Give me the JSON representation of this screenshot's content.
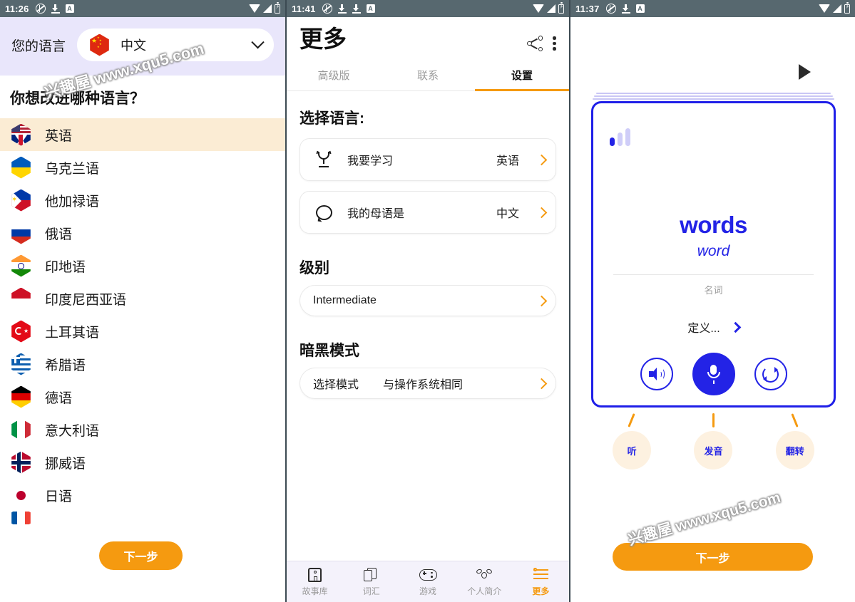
{
  "panel1": {
    "statusbar": {
      "time": "11:26",
      "icons_left": [
        "mute-icon",
        "download-icon",
        "app-badge-icon"
      ],
      "icons_right": [
        "wifi-icon",
        "signal-icon",
        "battery-icon"
      ]
    },
    "header": {
      "label": "您的语言",
      "selected_language": "中文",
      "flag": "cn",
      "chevron": "chevron-down-icon"
    },
    "question": "你想改进哪种语言？",
    "languages": [
      {
        "name": "英语",
        "flag": "uk-us",
        "selected": true
      },
      {
        "name": "乌克兰语",
        "flag": "ua",
        "selected": false
      },
      {
        "name": "他加禄语",
        "flag": "ph",
        "selected": false
      },
      {
        "name": "俄语",
        "flag": "ru",
        "selected": false
      },
      {
        "name": "印地语",
        "flag": "in",
        "selected": false
      },
      {
        "name": "印度尼西亚语",
        "flag": "id",
        "selected": false
      },
      {
        "name": "土耳其语",
        "flag": "tr",
        "selected": false
      },
      {
        "name": "希腊语",
        "flag": "gr",
        "selected": false
      },
      {
        "name": "德语",
        "flag": "de",
        "selected": false
      },
      {
        "name": "意大利语",
        "flag": "it",
        "selected": false
      },
      {
        "name": "挪威语",
        "flag": "no",
        "selected": false
      },
      {
        "name": "日语",
        "flag": "jp",
        "selected": false
      },
      {
        "name": "",
        "flag": "fr",
        "selected": false
      }
    ],
    "next_button": "下一步",
    "watermark": "兴趣屋 www.xqu5.com"
  },
  "panel2": {
    "statusbar": {
      "time": "11:41"
    },
    "title": "更多",
    "actions": {
      "share": "share-icon",
      "menu": "overflow-menu-icon"
    },
    "tabs": [
      {
        "label": "高级版",
        "active": false
      },
      {
        "label": "联系",
        "active": false
      },
      {
        "label": "设置",
        "active": true
      }
    ],
    "language_section": {
      "title": "选择语言:",
      "rows": [
        {
          "icon": "trophy-icon",
          "label": "我要学习",
          "value": "英语"
        },
        {
          "icon": "speech-bubble-icon",
          "label": "我的母语是",
          "value": "中文"
        }
      ]
    },
    "level_section": {
      "title": "级别",
      "value": "Intermediate"
    },
    "dark_mode_section": {
      "title": "暗黑模式",
      "label": "选择模式",
      "value": "与操作系统相同"
    },
    "bottom_nav": [
      {
        "label": "故事库",
        "icon": "story-library-icon",
        "active": false
      },
      {
        "label": "词汇",
        "icon": "vocabulary-cards-icon",
        "active": false
      },
      {
        "label": "游戏",
        "icon": "gamepad-icon",
        "active": false
      },
      {
        "label": "个人简介",
        "icon": "profile-bee-icon",
        "active": false
      },
      {
        "label": "更多",
        "icon": "sliders-icon",
        "active": true
      }
    ]
  },
  "panel3": {
    "statusbar": {
      "time": "11:37"
    },
    "play_button": "play-icon",
    "flashcard": {
      "level_indicator": "signal-bars-icon",
      "word": "words",
      "translation": "word",
      "part_of_speech": "名词",
      "definition_label": "定义...",
      "definition_chevron": "chevron-right-icon",
      "buttons": [
        {
          "name": "speaker-icon",
          "style": "outline"
        },
        {
          "name": "microphone-icon",
          "style": "filled"
        },
        {
          "name": "refresh-flip-icon",
          "style": "outline"
        }
      ]
    },
    "hints": [
      {
        "label": "听"
      },
      {
        "label": "发音"
      },
      {
        "label": "翻转"
      }
    ],
    "next_button": "下一步",
    "watermark": "兴趣屋 www.xqu5.com"
  },
  "colors": {
    "statusbar": "#57686f",
    "accent_orange": "#f59a10",
    "header_lavender": "#e9e6fb",
    "selected_row": "#fbecd4",
    "card_blue": "#2323e6",
    "hint_bubble": "#fdf1e0",
    "nav_bg": "#f4f2fb"
  }
}
